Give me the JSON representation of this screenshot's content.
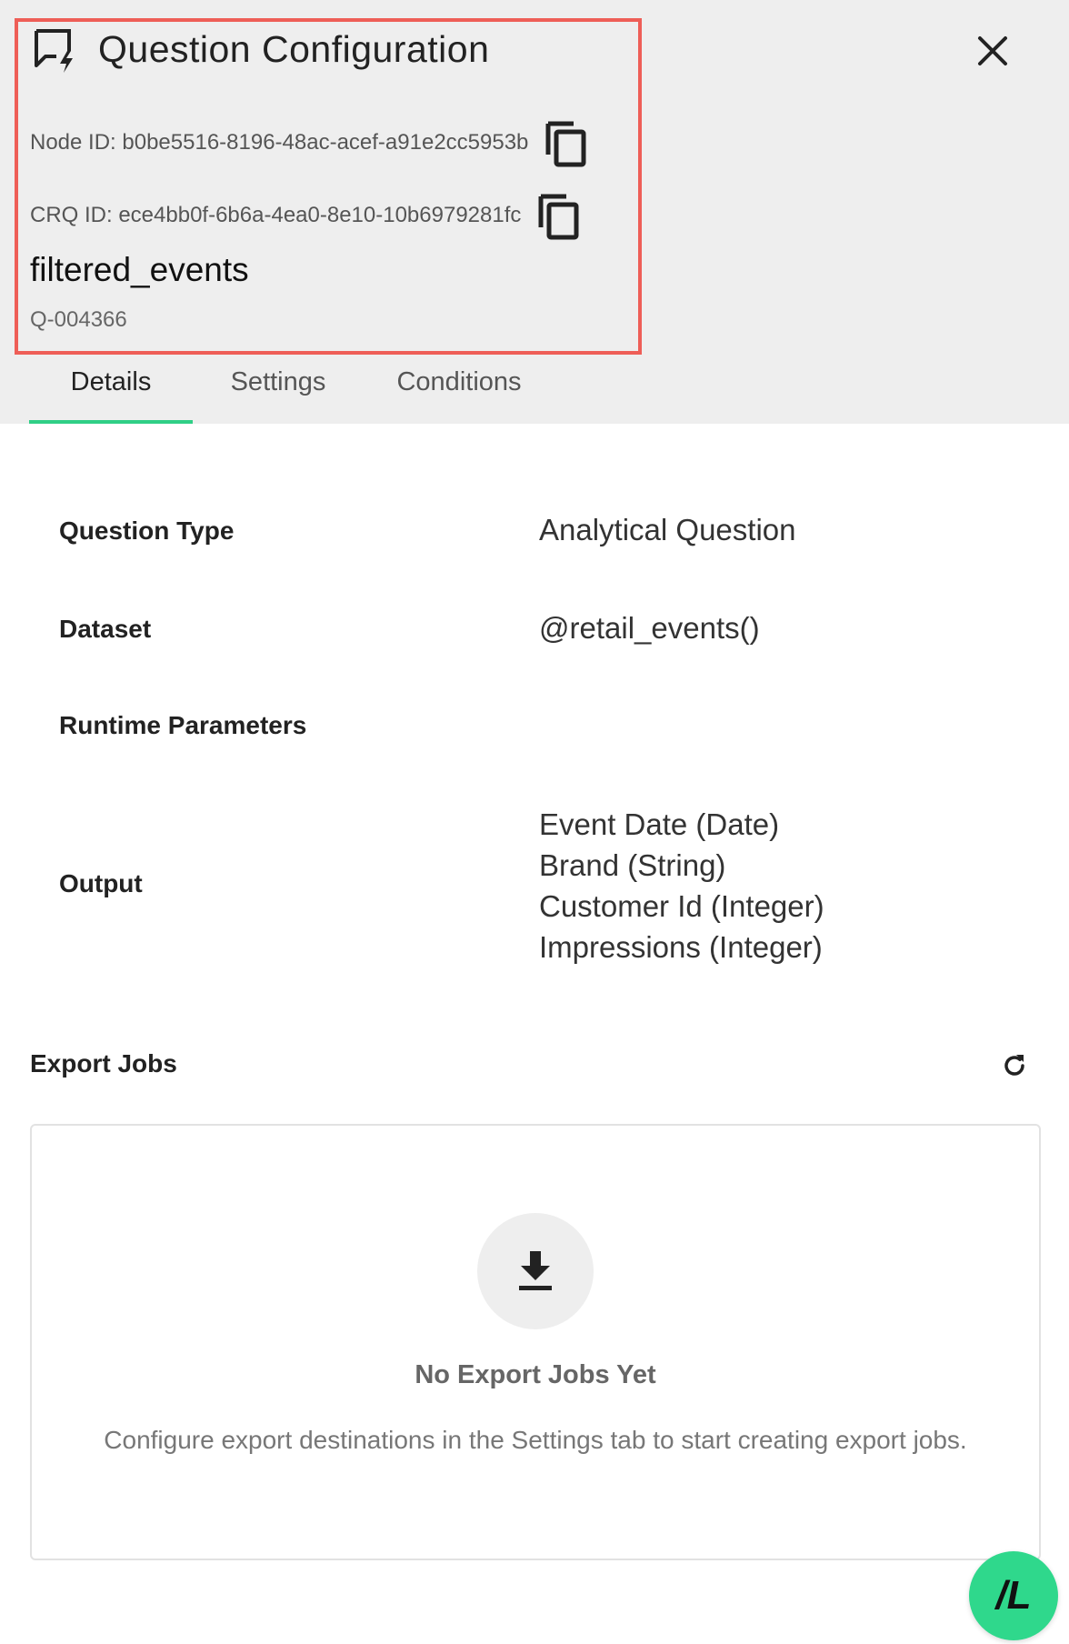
{
  "header": {
    "title": "Question Configuration",
    "node_id": "Node ID: b0be5516-8196-48ac-acef-a91e2cc5953b",
    "crq_id": "CRQ ID: ece4bb0f-6b6a-4ea0-8e10-10b6979281fc",
    "query_name": "filtered_events",
    "query_code": "Q-004366",
    "highlight_color": "#ee5e57"
  },
  "tabs": [
    {
      "label": "Details",
      "active": true
    },
    {
      "label": "Settings",
      "active": false
    },
    {
      "label": "Conditions",
      "active": false
    }
  ],
  "details": {
    "question_type_label": "Question Type",
    "question_type_value": "Analytical Question",
    "dataset_label": "Dataset",
    "dataset_value": "@retail_events()",
    "runtime_label": "Runtime Parameters",
    "output_label": "Output",
    "output_values": [
      "Event Date (Date)",
      "Brand (String)",
      "Customer Id (Integer)",
      "Impressions (Integer)"
    ]
  },
  "export_jobs": {
    "title": "Export Jobs",
    "empty_title": "No Export Jobs Yet",
    "empty_desc": "Configure export destinations in the Settings tab to start creating export jobs."
  },
  "fab": {
    "label": "/L"
  },
  "colors": {
    "accent": "#2fcf86",
    "fab": "#2fd88c",
    "header_bg": "#eeeeee"
  },
  "icons": [
    "message-flag-icon",
    "close-icon",
    "copy-icon",
    "refresh-icon",
    "download-icon"
  ]
}
